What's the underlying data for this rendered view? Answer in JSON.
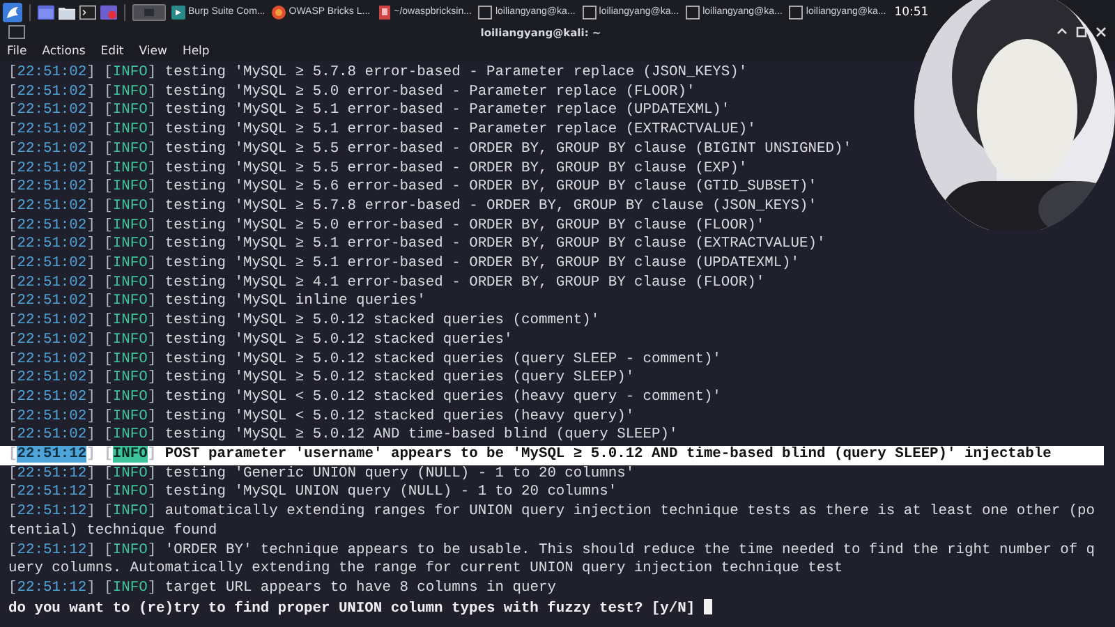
{
  "taskbar": {
    "tasks": [
      {
        "label": "Burp Suite Com...",
        "kind": "burp"
      },
      {
        "label": "OWASP Bricks L...",
        "kind": "browser"
      },
      {
        "label": "~/owaspbricksin...",
        "kind": "file"
      },
      {
        "label": "loiliangyang@ka...",
        "kind": "terminal"
      },
      {
        "label": "loiliangyang@ka...",
        "kind": "terminal"
      },
      {
        "label": "loiliangyang@ka...",
        "kind": "terminal"
      },
      {
        "label": "loiliangyang@ka...",
        "kind": "terminal"
      }
    ],
    "clock": "10:51"
  },
  "window": {
    "title": "loiliangyang@kali: ~"
  },
  "menu": [
    "File",
    "Actions",
    "Edit",
    "View",
    "Help"
  ],
  "terminal": {
    "lines": [
      {
        "kind": "log",
        "time": "[22:51:02]",
        "level": "[INFO]",
        "message": "testing 'MySQL ≥ 5.7.8 error-based - Parameter replace (JSON_KEYS)'",
        "highlighted": false
      },
      {
        "kind": "log",
        "time": "[22:51:02]",
        "level": "[INFO]",
        "message": "testing 'MySQL ≥ 5.0 error-based - Parameter replace (FLOOR)'",
        "highlighted": false
      },
      {
        "kind": "log",
        "time": "[22:51:02]",
        "level": "[INFO]",
        "message": "testing 'MySQL ≥ 5.1 error-based - Parameter replace (UPDATEXML)'",
        "highlighted": false
      },
      {
        "kind": "log",
        "time": "[22:51:02]",
        "level": "[INFO]",
        "message": "testing 'MySQL ≥ 5.1 error-based - Parameter replace (EXTRACTVALUE)'",
        "highlighted": false
      },
      {
        "kind": "log",
        "time": "[22:51:02]",
        "level": "[INFO]",
        "message": "testing 'MySQL ≥ 5.5 error-based - ORDER BY, GROUP BY clause (BIGINT UNSIGNED)'",
        "highlighted": false
      },
      {
        "kind": "log",
        "time": "[22:51:02]",
        "level": "[INFO]",
        "message": "testing 'MySQL ≥ 5.5 error-based - ORDER BY, GROUP BY clause (EXP)'",
        "highlighted": false
      },
      {
        "kind": "log",
        "time": "[22:51:02]",
        "level": "[INFO]",
        "message": "testing 'MySQL ≥ 5.6 error-based - ORDER BY, GROUP BY clause (GTID_SUBSET)'",
        "highlighted": false
      },
      {
        "kind": "log",
        "time": "[22:51:02]",
        "level": "[INFO]",
        "message": "testing 'MySQL ≥ 5.7.8 error-based - ORDER BY, GROUP BY clause (JSON_KEYS)'",
        "highlighted": false
      },
      {
        "kind": "log",
        "time": "[22:51:02]",
        "level": "[INFO]",
        "message": "testing 'MySQL ≥ 5.0 error-based - ORDER BY, GROUP BY clause (FLOOR)'",
        "highlighted": false
      },
      {
        "kind": "log",
        "time": "[22:51:02]",
        "level": "[INFO]",
        "message": "testing 'MySQL ≥ 5.1 error-based - ORDER BY, GROUP BY clause (EXTRACTVALUE)'",
        "highlighted": false
      },
      {
        "kind": "log",
        "time": "[22:51:02]",
        "level": "[INFO]",
        "message": "testing 'MySQL ≥ 5.1 error-based - ORDER BY, GROUP BY clause (UPDATEXML)'",
        "highlighted": false
      },
      {
        "kind": "log",
        "time": "[22:51:02]",
        "level": "[INFO]",
        "message": "testing 'MySQL ≥ 4.1 error-based - ORDER BY, GROUP BY clause (FLOOR)'",
        "highlighted": false
      },
      {
        "kind": "log",
        "time": "[22:51:02]",
        "level": "[INFO]",
        "message": "testing 'MySQL inline queries'",
        "highlighted": false
      },
      {
        "kind": "log",
        "time": "[22:51:02]",
        "level": "[INFO]",
        "message": "testing 'MySQL ≥ 5.0.12 stacked queries (comment)'",
        "highlighted": false
      },
      {
        "kind": "log",
        "time": "[22:51:02]",
        "level": "[INFO]",
        "message": "testing 'MySQL ≥ 5.0.12 stacked queries'",
        "highlighted": false
      },
      {
        "kind": "log",
        "time": "[22:51:02]",
        "level": "[INFO]",
        "message": "testing 'MySQL ≥ 5.0.12 stacked queries (query SLEEP - comment)'",
        "highlighted": false
      },
      {
        "kind": "log",
        "time": "[22:51:02]",
        "level": "[INFO]",
        "message": "testing 'MySQL ≥ 5.0.12 stacked queries (query SLEEP)'",
        "highlighted": false
      },
      {
        "kind": "log",
        "time": "[22:51:02]",
        "level": "[INFO]",
        "message": "testing 'MySQL < 5.0.12 stacked queries (heavy query - comment)'",
        "highlighted": false
      },
      {
        "kind": "log",
        "time": "[22:51:02]",
        "level": "[INFO]",
        "message": "testing 'MySQL < 5.0.12 stacked queries (heavy query)'",
        "highlighted": false
      },
      {
        "kind": "log",
        "time": "[22:51:02]",
        "level": "[INFO]",
        "message": "testing 'MySQL ≥ 5.0.12 AND time-based blind (query SLEEP)'",
        "highlighted": false
      },
      {
        "kind": "log",
        "time": "[22:51:12]",
        "level": "[INFO]",
        "message": "POST parameter 'username' appears to be 'MySQL ≥ 5.0.12 AND time-based blind (query SLEEP)' injectable",
        "highlighted": true
      },
      {
        "kind": "log",
        "time": "[22:51:12]",
        "level": "[INFO]",
        "message": "testing 'Generic UNION query (NULL) - 1 to 20 columns'",
        "highlighted": false
      },
      {
        "kind": "log",
        "time": "[22:51:12]",
        "level": "[INFO]",
        "message": "testing 'MySQL UNION query (NULL) - 1 to 20 columns'",
        "highlighted": false
      },
      {
        "kind": "log",
        "time": "[22:51:12]",
        "level": "[INFO]",
        "message": "automatically extending ranges for UNION query injection technique tests as there is at least one other (potential) technique found",
        "highlighted": false
      },
      {
        "kind": "log",
        "time": "[22:51:12]",
        "level": "[INFO]",
        "message": "'ORDER BY' technique appears to be usable. This should reduce the time needed to find the right number of query columns. Automatically extending the range for current UNION query injection technique test",
        "highlighted": false
      },
      {
        "kind": "log",
        "time": "[22:51:12]",
        "level": "[INFO]",
        "message": "target URL appears to have 8 columns in query",
        "highlighted": false
      },
      {
        "kind": "prompt",
        "text": "do you want to (re)try to find proper UNION column types with fuzzy test? [y/N]"
      }
    ]
  }
}
